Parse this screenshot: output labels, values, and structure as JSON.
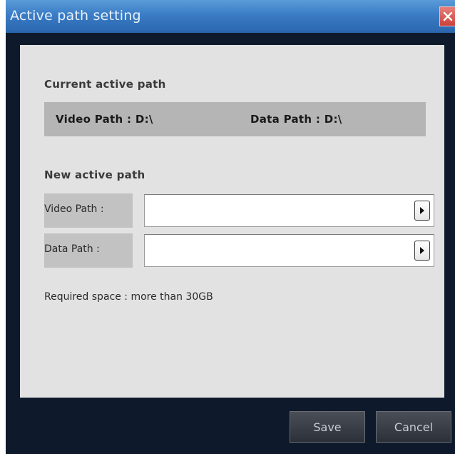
{
  "window": {
    "title": "Active path setting",
    "close_icon": "close-icon"
  },
  "current": {
    "heading": "Current active path",
    "video": "Video Path : D:\\",
    "data": "Data Path : D:\\"
  },
  "new_path": {
    "heading": "New active path",
    "video_label": "Video Path :",
    "video_value": "",
    "data_label": "Data Path :",
    "data_value": "",
    "browse_icon": "play-arrow-icon"
  },
  "note": "Required space : more than 30GB",
  "buttons": {
    "save": "Save",
    "cancel": "Cancel"
  },
  "colors": {
    "titlebar": "#3a7cc5",
    "close": "#c9423a",
    "panel": "#e2e2e2",
    "footer": "#0e1a2b"
  }
}
